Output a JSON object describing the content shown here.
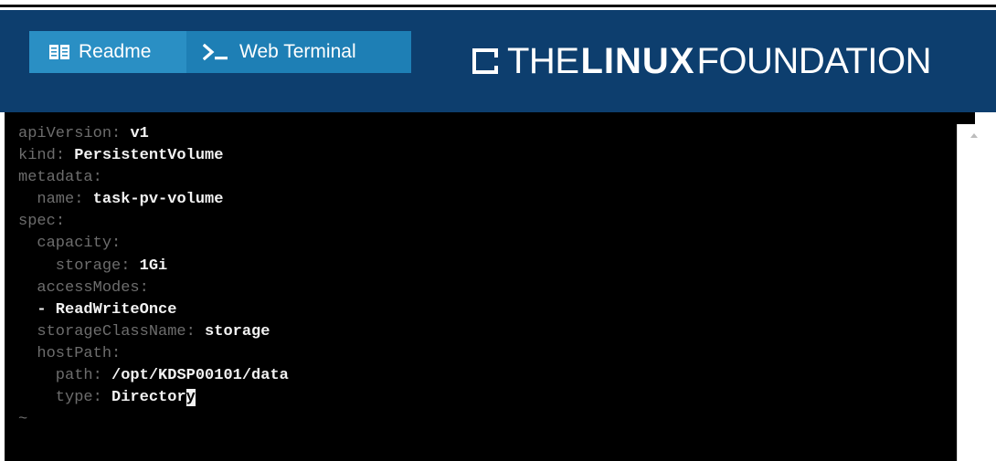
{
  "header": {
    "tabs": [
      {
        "label": "Readme",
        "icon": "book-icon"
      },
      {
        "label": "Web Terminal",
        "icon": "terminal-prompt-icon"
      }
    ],
    "logo": {
      "part1": "THE",
      "part2": "LINUX",
      "part3": "FOUNDATION",
      "icon": "linux-foundation-mark-icon"
    },
    "colors": {
      "header_bg": "#0d3e6e",
      "tab_readme_bg": "#2a8fc4",
      "tab_terminal_bg": "#1e7fb5",
      "terminal_bg": "#000000",
      "yaml_key": "#6d6d6d",
      "yaml_value": "#f2f2f2"
    }
  },
  "terminal": {
    "lines": [
      {
        "key": "apiVersion",
        "sep": ": ",
        "value": "v1"
      },
      {
        "key": "kind",
        "sep": ": ",
        "value": "PersistentVolume"
      },
      {
        "key": "metadata",
        "sep": ":",
        "value": ""
      },
      {
        "key": "  name",
        "sep": ": ",
        "value": "task-pv-volume"
      },
      {
        "key": "spec",
        "sep": ":",
        "value": ""
      },
      {
        "key": "  capacity",
        "sep": ":",
        "value": ""
      },
      {
        "key": "    storage",
        "sep": ": ",
        "value": "1Gi"
      },
      {
        "key": "  accessModes",
        "sep": ":",
        "value": ""
      },
      {
        "key": "  ",
        "sep": "",
        "value": "- ReadWriteOnce"
      },
      {
        "key": "  storageClassName",
        "sep": ": ",
        "value": "storage"
      },
      {
        "key": "  hostPath",
        "sep": ":",
        "value": ""
      },
      {
        "key": "    path",
        "sep": ": ",
        "value": "/opt/KDSP00101/data"
      },
      {
        "key": "    type",
        "sep": ": ",
        "value": "Director",
        "cursor_char": "y"
      }
    ],
    "empty_line_marker": "~"
  }
}
